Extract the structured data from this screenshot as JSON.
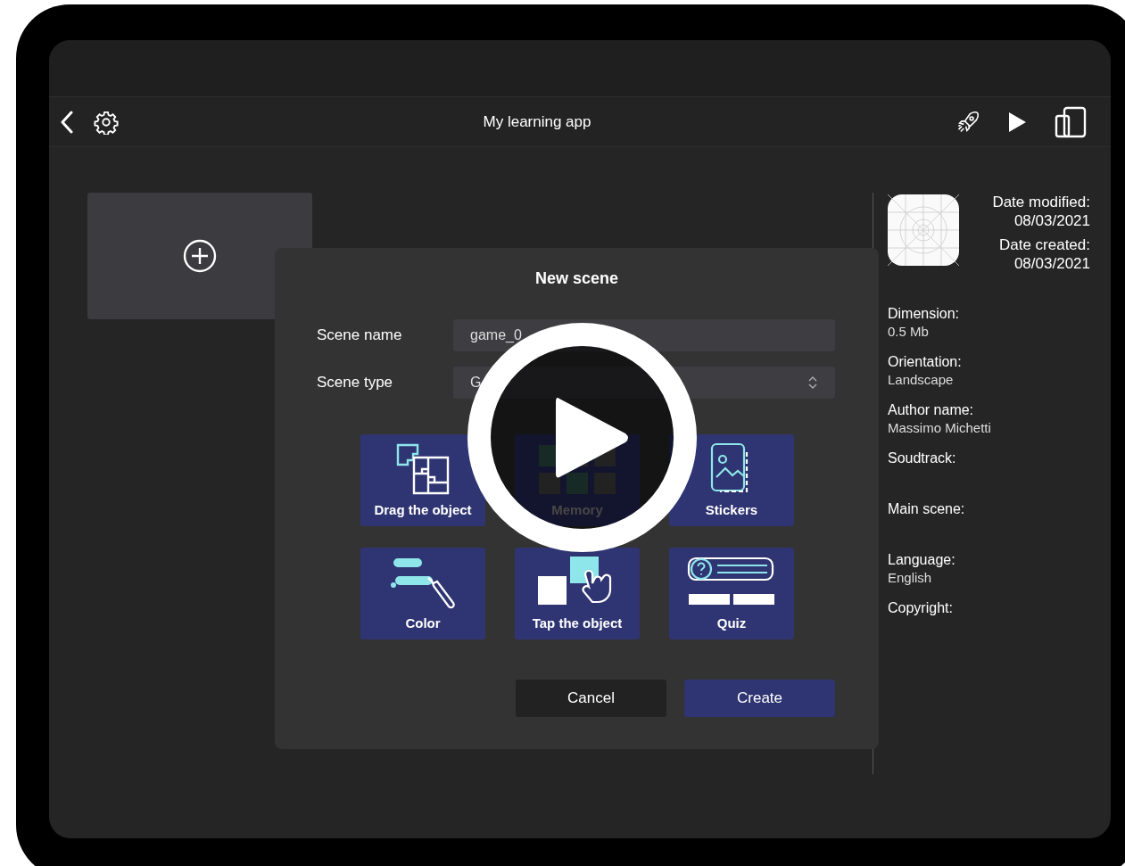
{
  "toolbar": {
    "title": "My learning app"
  },
  "dialog": {
    "title": "New scene",
    "fields": [
      {
        "label": "Scene name",
        "value": "game_0",
        "kind": "text"
      },
      {
        "label": "Scene type",
        "value": "G",
        "kind": "select"
      }
    ],
    "tiles": [
      {
        "label": "Drag the object",
        "kind": "puzzle"
      },
      {
        "label": "Memory",
        "kind": "memory"
      },
      {
        "label": "Stickers",
        "kind": "stickers"
      },
      {
        "label": "Color",
        "kind": "color"
      },
      {
        "label": "Tap the object",
        "kind": "tap"
      },
      {
        "label": "Quiz",
        "kind": "quiz"
      }
    ],
    "buttons": [
      {
        "label": "Cancel",
        "kind": "secondary"
      },
      {
        "label": "Create",
        "kind": "primary"
      }
    ]
  },
  "info": {
    "dates": [
      {
        "label": "Date modified:",
        "value": "08/03/2021"
      },
      {
        "label": "Date created:",
        "value": "08/03/2021"
      }
    ],
    "fields": [
      {
        "label": "Dimension:",
        "value": "0.5 Mb"
      },
      {
        "label": "Orientation:",
        "value": "Landscape"
      },
      {
        "label": "Author name:",
        "value": "Massimo Michetti"
      },
      {
        "label": "Soudtrack:"
      },
      {
        "label": "Main scene:"
      },
      {
        "label": "Language:",
        "value": "English"
      },
      {
        "label": "Copyright:"
      }
    ]
  }
}
